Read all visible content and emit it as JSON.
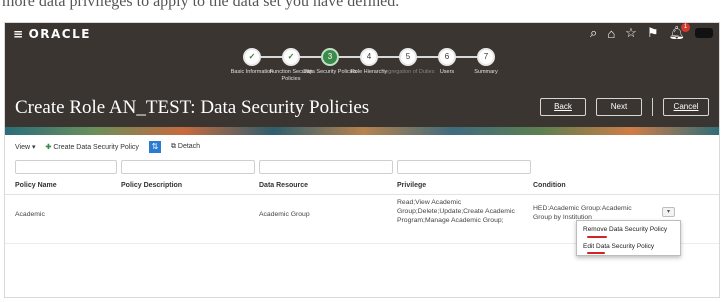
{
  "top_text": "more data privileges to apply to the data set you have defined.",
  "header": {
    "logo": "ORACLE",
    "hamburger": "≡",
    "title": "Create Role AN_TEST: Data Security Policies",
    "notification_count": "1",
    "buttons": {
      "back": "Back",
      "next": "Next",
      "cancel": "Cancel"
    }
  },
  "train": [
    {
      "num": "✓",
      "label": "Basic Information",
      "state": "done"
    },
    {
      "num": "✓",
      "label": "Function Security Policies",
      "state": "done"
    },
    {
      "num": "3",
      "label": "Data Security Policies",
      "state": "current"
    },
    {
      "num": "4",
      "label": "Role Hierarchy",
      "state": "future"
    },
    {
      "num": "5",
      "label": "Segregation of Duties",
      "state": "disabled"
    },
    {
      "num": "6",
      "label": "Users",
      "state": "future"
    },
    {
      "num": "7",
      "label": "Summary",
      "state": "future"
    }
  ],
  "toolbar": {
    "view": "View ▾",
    "create": "Create Data Security Policy",
    "detach": "Detach"
  },
  "table": {
    "columns": [
      "Policy Name",
      "Policy Description",
      "Data Resource",
      "Privilege",
      "Condition"
    ],
    "rows": [
      {
        "policy_name": "Academic",
        "policy_description": "",
        "data_resource": "Academic Group",
        "privilege": "Read;View Academic Group;Delete;Update;Create Academic Program;Manage Academic Group;",
        "condition": "HED:Academic Group:Academic Group by Institution"
      }
    ]
  },
  "menu": {
    "items": [
      "Remove Data Security Policy",
      "Edit Data Security Policy"
    ]
  },
  "colors": {
    "current_step": "#3a8a4a",
    "header_bg": "#3b3531",
    "highlight": "#d32424",
    "detach_icon": "#2b7bd1"
  }
}
